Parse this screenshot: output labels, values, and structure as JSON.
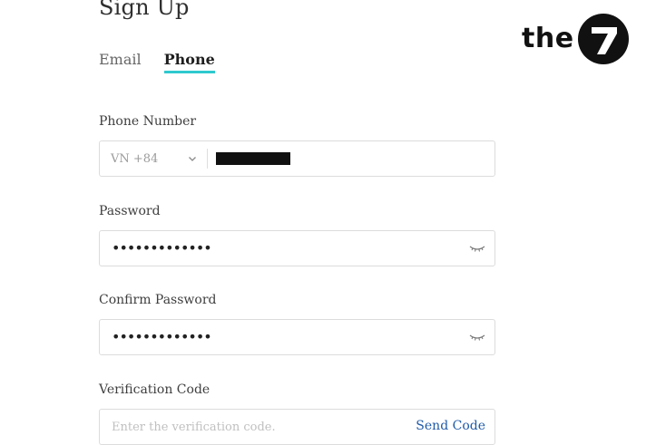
{
  "form": {
    "title": "Sign Up"
  },
  "logo": {
    "text": "the",
    "badge": "7"
  },
  "tabs": [
    {
      "label": "Email",
      "active": false
    },
    {
      "label": "Phone",
      "active": true
    }
  ],
  "phone": {
    "label": "Phone Number",
    "country_code": "VN +84"
  },
  "password": {
    "label": "Password",
    "masked_value": "•••••••••••••"
  },
  "confirm_password": {
    "label": "Confirm Password",
    "masked_value": "•••••••••••••"
  },
  "verification": {
    "label": "Verification Code",
    "placeholder": "Enter the verification code.",
    "send_label": "Send Code"
  },
  "colors": {
    "tab_underline": "#2ec9cf",
    "link": "#1f5aa8"
  }
}
